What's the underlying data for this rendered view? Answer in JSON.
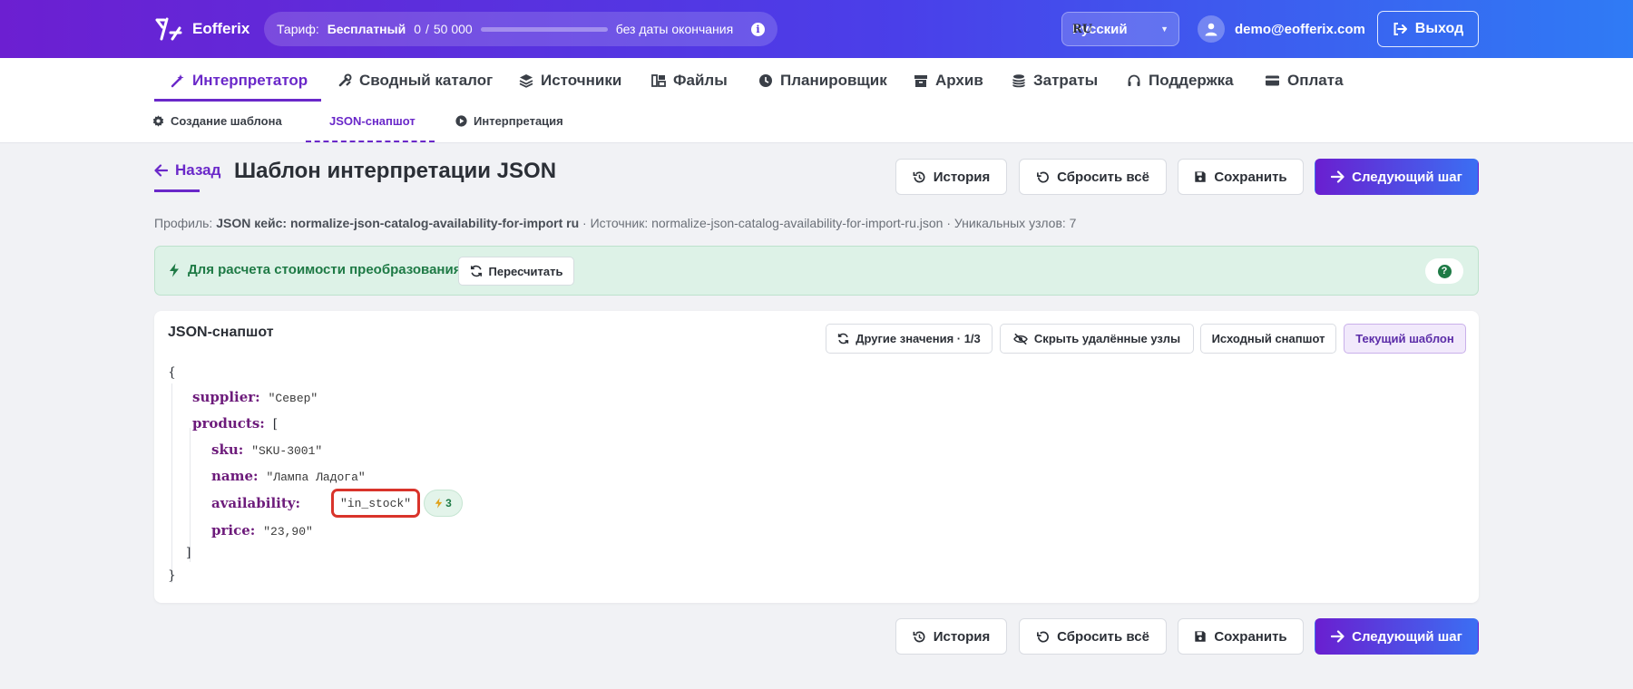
{
  "topbar": {
    "brand": "Eofferix",
    "tariff_label": "Тариф:",
    "tariff_plan": "Бесплатный",
    "tariff_used": "0",
    "tariff_sep": "/",
    "tariff_limit": "50 000",
    "tariff_usage_fraction": 0,
    "tariff_expiry": "без даты окончания",
    "lang_code": "RU",
    "lang_name": "Русский",
    "user_email": "demo@eofferix.com",
    "logout_label": "Выход"
  },
  "main_nav": [
    {
      "label": "Интерпретатор",
      "icon": "magic-wand-icon",
      "active": true
    },
    {
      "label": "Сводный каталог",
      "icon": "tools-icon",
      "active": false
    },
    {
      "label": "Источники",
      "icon": "layers-icon",
      "active": false
    },
    {
      "label": "Файлы",
      "icon": "folders-icon",
      "active": false
    },
    {
      "label": "Планировщик",
      "icon": "clock-icon",
      "active": false
    },
    {
      "label": "Архив",
      "icon": "archive-icon",
      "active": false
    },
    {
      "label": "Затраты",
      "icon": "coins-icon",
      "active": false
    },
    {
      "label": "Поддержка",
      "icon": "headset-icon",
      "active": false
    },
    {
      "label": "Оплата",
      "icon": "card-icon",
      "active": false
    }
  ],
  "sub_nav": [
    {
      "label": "Создание шаблона",
      "icon": "gear-icon",
      "active": false
    },
    {
      "label": "JSON-снапшот",
      "icon": "",
      "active": true
    },
    {
      "label": "Интерпретация",
      "icon": "play-icon",
      "active": false
    }
  ],
  "header": {
    "back_label": "Назад",
    "title": "Шаблон интерпретации JSON",
    "actions": {
      "history": "История",
      "reset_all": "Сбросить всё",
      "save": "Сохранить",
      "next_step": "Следующий шаг"
    }
  },
  "profile_line": {
    "profile_label": "Профиль:",
    "profile_value": "JSON кейс: normalize-json-catalog-availability-for-import ru",
    "source_text": "· Источник: normalize-json-catalog-availability-for-import-ru.json · Уникальных узлов: 7"
  },
  "cost_banner": {
    "text": "Для расчета стоимости преобразования",
    "recalc_label": "Пересчитать",
    "help_glyph": "?"
  },
  "snapshot": {
    "title": "JSON-снапшот",
    "toolbar": {
      "other_values": "Другие значения · 1/3",
      "hide_deleted": "Скрыть удалённые узлы",
      "original_snapshot": "Исходный снапшот",
      "current_template": "Текущий шаблон"
    },
    "json": {
      "open_brace": "{",
      "close_brace": "}",
      "supplier_key": "supplier:",
      "supplier_value": "\"Север\"",
      "products_key": "products:",
      "products_open": "[",
      "products_close": "]",
      "sku_key": "sku:",
      "sku_value": "\"SKU-3001\"",
      "name_key": "name:",
      "name_value": "\"Лампа Ладога\"",
      "availability_key": "availability:",
      "availability_value": "\"in_stock\"",
      "availability_badge": "3",
      "price_key": "price:",
      "price_value": "\"23,90\""
    }
  },
  "colors": {
    "accent": "#6a28c9",
    "topbar_gradient_start": "#6c1fd1",
    "topbar_gradient_end": "#2f7bf5",
    "success": "#1e7a45",
    "highlight_border": "#d9342b"
  }
}
